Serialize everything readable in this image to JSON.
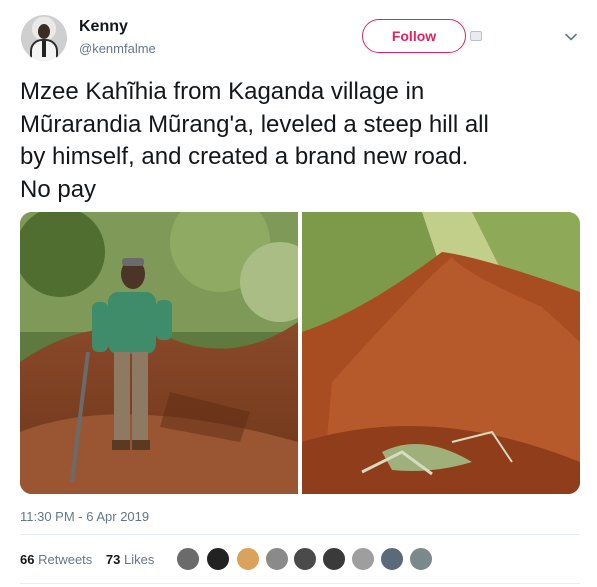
{
  "user": {
    "name": "Kenny",
    "handle": "@kenmfalme"
  },
  "follow_label": "Follow",
  "tweet": {
    "lines": [
      "Mzee Kahĩhia from Kaganda village in",
      "Mũrarandia Mũrang'a, leveled a steep hill all",
      "by himself, and created a brand new road.",
      "No pay"
    ],
    "timestamp": "11:30 PM - 6 Apr 2019"
  },
  "stats": {
    "retweets_count": "66",
    "retweets_label": "Retweets",
    "likes_count": "73",
    "likes_label": "Likes"
  },
  "icons": [
    "chevron-down-icon",
    "embed-icon"
  ],
  "colors": {
    "follow": "#e0245e",
    "secondary_text": "#657786",
    "primary_text": "#14171a",
    "divider": "#e6ecf0"
  },
  "likers_count": 9
}
